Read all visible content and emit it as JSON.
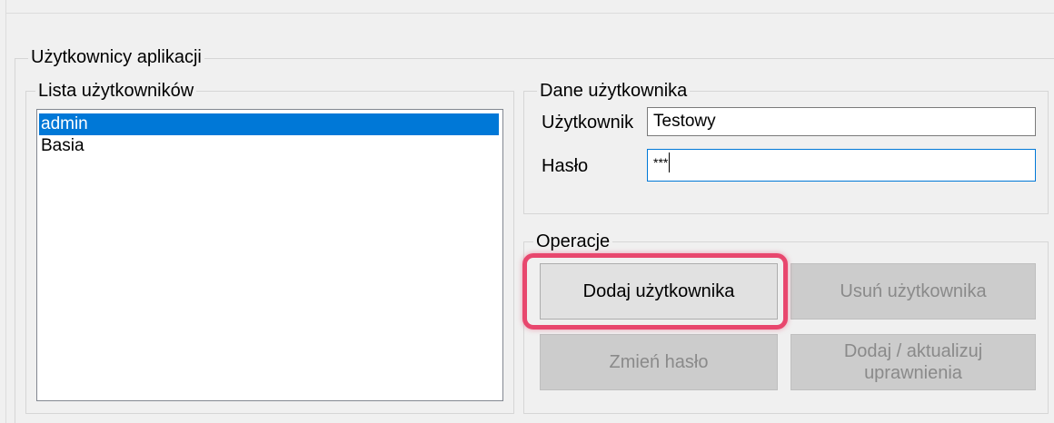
{
  "app_users_group": {
    "title": "Użytkownicy aplikacji"
  },
  "user_list_group": {
    "title": "Lista użytkowników",
    "items": [
      {
        "label": "admin",
        "selected": true
      },
      {
        "label": "Basia",
        "selected": false
      }
    ]
  },
  "user_data_group": {
    "title": "Dane użytkownika",
    "user_label": "Użytkownik",
    "user_value": "Testowy",
    "password_label": "Hasło",
    "password_value": "***"
  },
  "operations_group": {
    "title": "Operacje",
    "add_user": "Dodaj użytkownika",
    "remove_user": "Usuń użytkownika",
    "change_password": "Zmień hasło",
    "permissions_line1": "Dodaj / aktualizuj",
    "permissions_line2": "uprawnienia"
  },
  "colors": {
    "selection": "#0078d7",
    "highlight": "#e8476e",
    "disabled_button": "#cccccc"
  }
}
